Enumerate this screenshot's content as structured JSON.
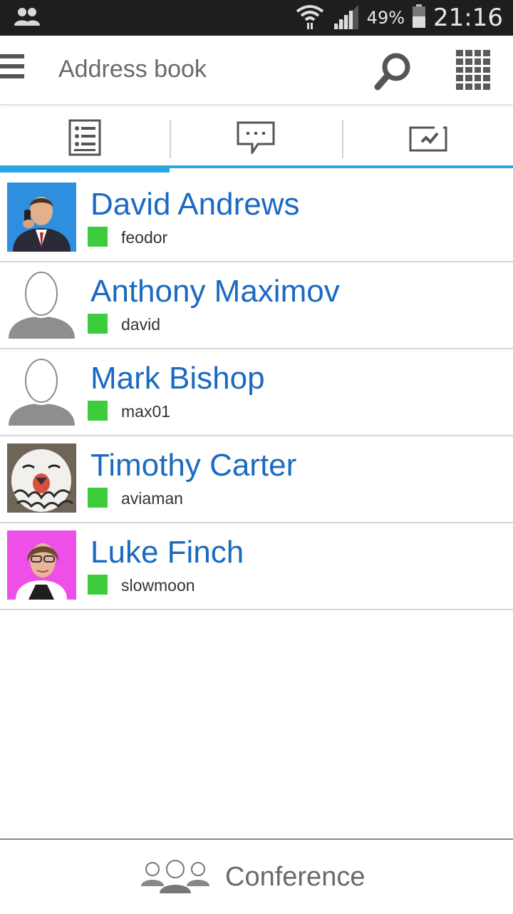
{
  "status_bar": {
    "battery": "49%",
    "time": "21:16",
    "icons": [
      "contacts-notification-icon",
      "wifi-icon",
      "signal-icon",
      "battery-icon"
    ]
  },
  "app_bar": {
    "title": "Address book",
    "icons": [
      "menu-icon",
      "search-icon",
      "keypad-icon"
    ]
  },
  "tabs": [
    {
      "icon": "contacts-list-icon",
      "active": true
    },
    {
      "icon": "chat-icon",
      "active": false
    },
    {
      "icon": "call-history-icon",
      "active": false
    }
  ],
  "contacts": [
    {
      "name": "David Andrews",
      "login": "feodor",
      "status_color": "#3ccc3c",
      "avatar": "photo"
    },
    {
      "name": "Anthony Maximov",
      "login": "david",
      "status_color": "#3ccc3c",
      "avatar": "default"
    },
    {
      "name": "Mark Bishop",
      "login": "max01",
      "status_color": "#3ccc3c",
      "avatar": "default"
    },
    {
      "name": "Timothy Carter",
      "login": "aviaman",
      "status_color": "#3ccc3c",
      "avatar": "owl-photo"
    },
    {
      "name": "Luke Finch",
      "login": "slowmoon",
      "status_color": "#3ccc3c",
      "avatar": "photo"
    }
  ],
  "bottom": {
    "conference_label": "Conference",
    "icon": "conference-icon"
  },
  "colors": {
    "accent": "#29a8e0",
    "name_text": "#1b6ac0",
    "online": "#3ccc3c"
  }
}
